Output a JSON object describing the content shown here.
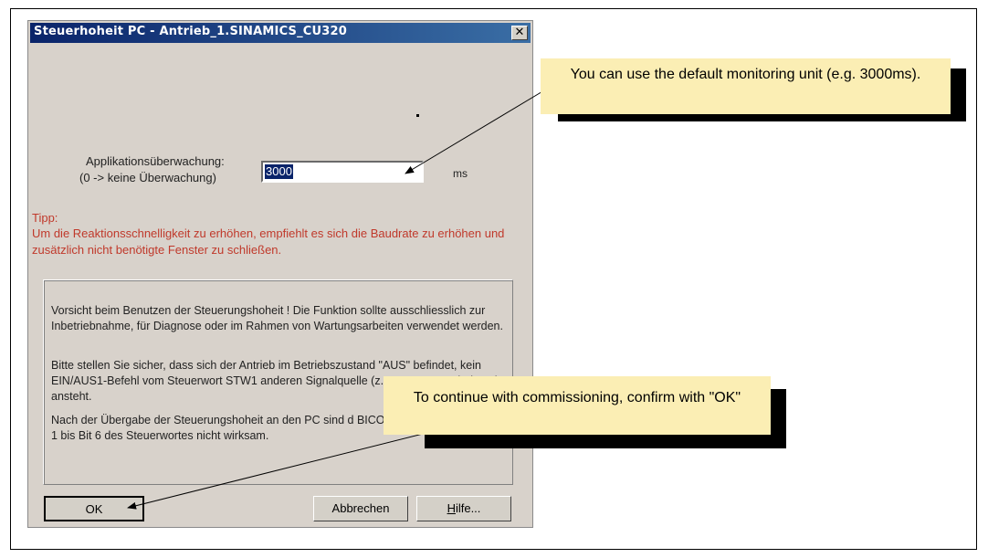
{
  "dialog": {
    "title": "Steuerhoheit PC - Antrieb_1.SINAMICS_CU320",
    "close_glyph": "✕",
    "label_line1": "Applikationsüberwachung:",
    "label_line2": "(0 -> keine Überwachung)",
    "input_value": "3000",
    "unit": "ms",
    "tip_heading": "Tipp:",
    "tip_text": "Um die Reaktionsschnelligkeit zu erhöhen, empfiehlt es sich die Baudrate zu erhöhen und zusätzlich nicht benötigte Fenster zu schließen.",
    "warning_p1": "Vorsicht beim Benutzen der Steuerungshoheit ! Die Funktion sollte ausschliesslich zur Inbetriebnahme, für Diagnose oder im Rahmen von Wartungsarbeiten verwendet werden.",
    "warning_p2": "Bitte stellen Sie sicher, dass sich der Antrieb im Betriebszustand \"AUS\" befindet, kein EIN/AUS1-Befehl vom Steuerwort STW1 anderen Signalquelle (z.B. BICO-Verschaltung) ansteht.",
    "warning_p3": "Nach der Übergabe der Steuerungshoheit an den PC sind d BICO-Verschaltungen auf Bit 1 bis Bit 6 des Steuerwortes nicht wirksam.",
    "ok_label": "OK",
    "cancel_label": "Abbrechen",
    "help_first": "H",
    "help_rest": "ilfe..."
  },
  "callouts": {
    "monitoring": "You can use the default monitoring unit (e.g. 3000ms).",
    "confirm": "To continue with commissioning, confirm with \"OK\""
  },
  "colors": {
    "title_bar": "#0a246a",
    "dialog_bg": "#d8d2cb",
    "tip_text": "#c0392b",
    "callout_bg": "#fbeeb4"
  }
}
